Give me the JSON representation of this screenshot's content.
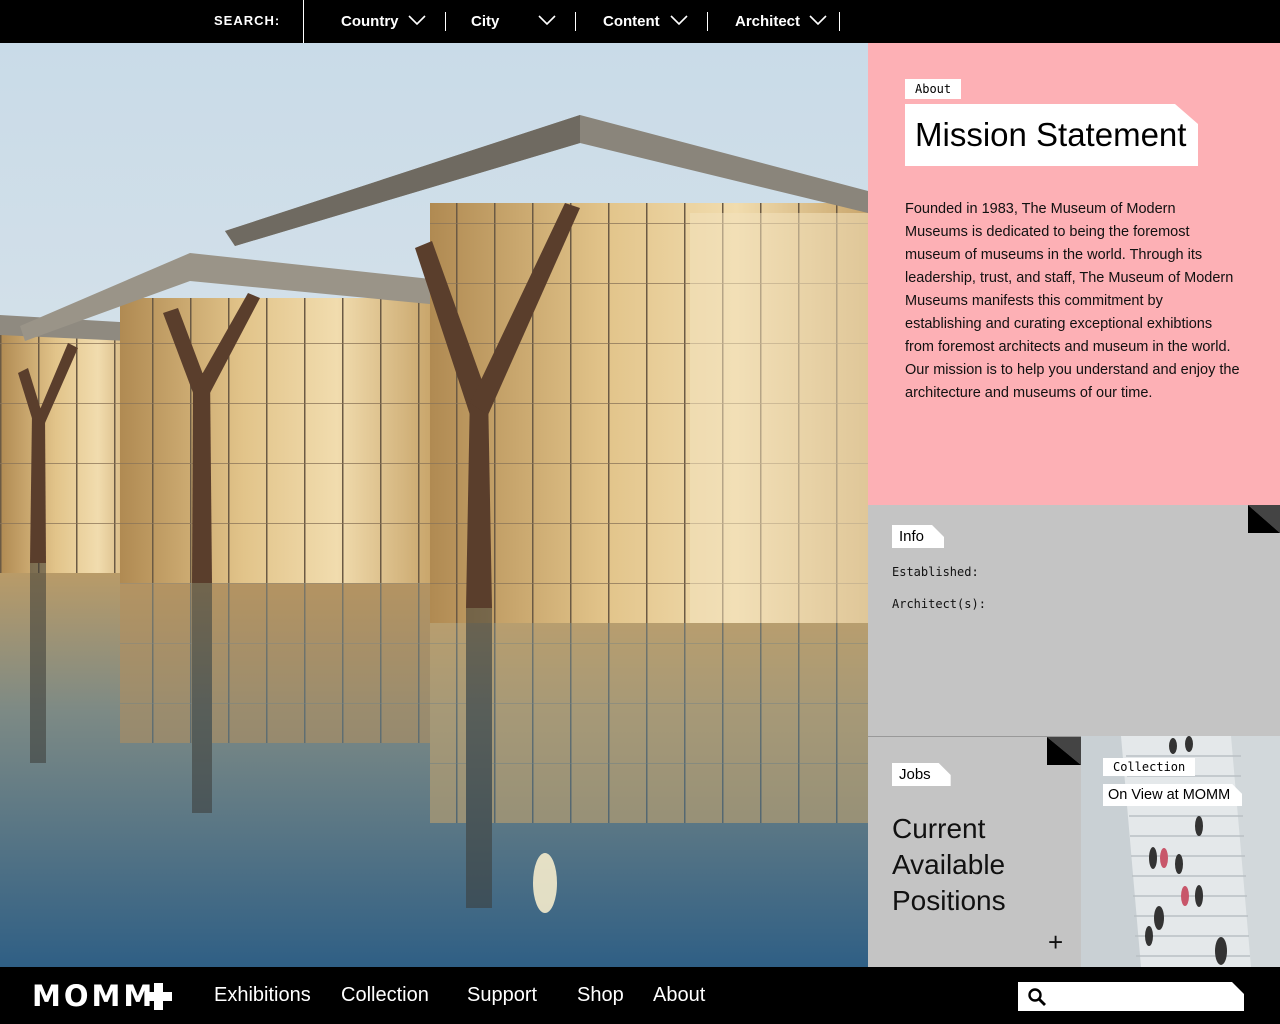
{
  "topbar": {
    "search_label": "SEARCH:",
    "filters": [
      {
        "label": "Country"
      },
      {
        "label": "City"
      },
      {
        "label": "Content"
      },
      {
        "label": "Architect"
      }
    ]
  },
  "about": {
    "tag": "About",
    "title": "Mission Statement",
    "text": "Founded in 1983, The Museum of Modern Museums is dedicated to being the foremost museum of museums in the world. Through its leadership, trust, and staff,  The Museum of Modern Museums manifests this commitment by establishing and curating exceptional exhibtions from foremost architects and museum in the world. Our mission is to help you understand and enjoy the architecture and museums of our time."
  },
  "info": {
    "tag": "Info",
    "established_label": "Established:",
    "architects_label": "Architect(s):"
  },
  "jobs": {
    "tag": "Jobs",
    "title": "Current Available Positions",
    "expand_symbol": "+"
  },
  "collection": {
    "tag": "Collection",
    "link": "On View at MOMM"
  },
  "bottombar": {
    "logo": "MOMM",
    "nav": [
      "Exhibitions",
      "Collection",
      "Support",
      "Shop",
      "About"
    ],
    "search_placeholder": ""
  },
  "colors": {
    "pink_panel": "#fdb0b5",
    "gray_panel": "#c4c4c4",
    "bar": "#000000"
  },
  "icons": {
    "dropdown": "chevron-down-icon",
    "search": "magnifier-icon",
    "logo_mark": "plus-icon"
  }
}
